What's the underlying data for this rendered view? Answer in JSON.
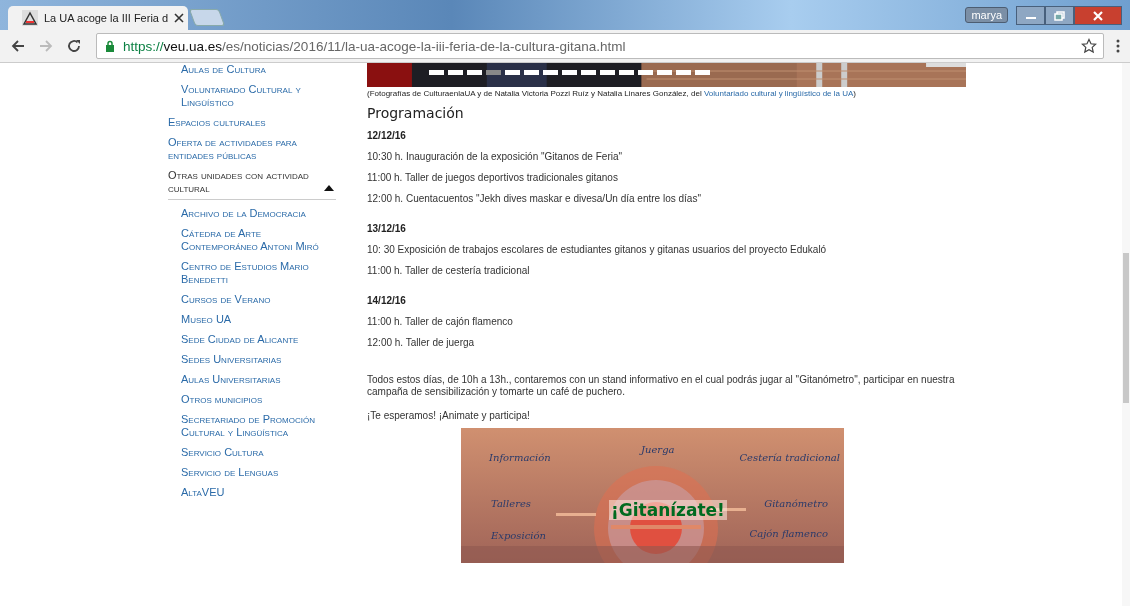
{
  "browser": {
    "tab": {
      "title": "La UA acoge la III Feria d",
      "selected": true
    },
    "user": "marya",
    "url": {
      "scheme": "https://",
      "host": "veu.ua.es",
      "path": "/es/noticias/2016/11/la-ua-acoge-la-iii-feria-de-la-cultura-gitana.html"
    }
  },
  "sidebar": {
    "items_continued": [
      {
        "label": "Aulas de Cultura"
      },
      {
        "label": "Voluntariado Cultural y Lingüístico"
      }
    ],
    "items": [
      {
        "label": "Espacios culturales"
      },
      {
        "label": "Oferta de actividades para entidades públicas"
      },
      {
        "label": "Otras unidades con actividad cultural",
        "expanded": true,
        "children": [
          {
            "label": "Archivo de la Democracia"
          },
          {
            "label": "Cátedra de Arte Contemporáneo Antoni Miró"
          },
          {
            "label": "Centro de Estudios Mario Benedetti"
          },
          {
            "label": "Cursos de Verano"
          },
          {
            "label": "Museo UA"
          },
          {
            "label": "Sede Ciudad de Alicante"
          },
          {
            "label": "Sedes Universitarias"
          },
          {
            "label": "Aulas Universitarias"
          },
          {
            "label": "Otros municipios"
          },
          {
            "label": "Secretariado de Promoción Cultural y Lingüística"
          },
          {
            "label": "Servicio Cultura"
          },
          {
            "label": "Servicio de Lenguas"
          },
          {
            "label": "AltaVEU"
          }
        ]
      }
    ]
  },
  "slideshow": {
    "dots": [
      {
        "selected": false
      },
      {
        "selected": false
      },
      {
        "selected": false
      },
      {
        "selected": true
      },
      {
        "selected": false
      },
      {
        "selected": false
      },
      {
        "selected": false
      },
      {
        "selected": false
      },
      {
        "selected": false
      },
      {
        "selected": false
      },
      {
        "selected": false
      },
      {
        "selected": false
      },
      {
        "selected": false
      },
      {
        "selected": false
      },
      {
        "selected": false
      }
    ]
  },
  "caption": {
    "text": "(Fotografías de CulturaenlaUA y de Natalia Victoria Pozzi Ruíz y Natalia Linares González, del ",
    "link": "Voluntariado cultural y lingüístico de la UA",
    "end": ")"
  },
  "heading": "Programación",
  "days": [
    {
      "date": "12/12/16",
      "events": [
        "10:30 h. Inauguración de la exposición \"Gitanos de Feria\"",
        "11:00 h. Taller de juegos deportivos tradicionales gitanos",
        "12:00 h. Cuentacuentos \"Jekh dives maskar e divesa/Un día entre los días\""
      ]
    },
    {
      "date": "13/12/16",
      "events": [
        "10: 30 Exposición de trabajos escolares de estudiantes gitanos y gitanas usuarios del proyecto Edukaló",
        "11:00 h. Taller de cestería tradicional"
      ]
    },
    {
      "date": "14/12/16",
      "events": [
        "11:00 h. Taller de cajón flamenco",
        "12:00 h. Taller de juerga"
      ]
    }
  ],
  "paragraph": "Todos estos días, de 10h a 13h., contaremos con un stand informativo en el cual podrás jugar al \"Gitanómetro\", participar en nuestra campaña de sensibilización y tomarte un café de puchero.",
  "closing": "¡Te esperamos! ¡Animate y participa!",
  "poster": {
    "words": [
      {
        "text": "Información",
        "kind": "word"
      },
      {
        "text": "Juerga",
        "kind": "word"
      },
      {
        "text": "Cestería tradicional",
        "kind": "word"
      },
      {
        "text": "Talleres",
        "kind": "word"
      },
      {
        "text": "¡Gitanízate!",
        "kind": "title"
      },
      {
        "text": "Gitanómetro",
        "kind": "word"
      },
      {
        "text": "Exposición",
        "kind": "word"
      },
      {
        "text": "Cajón flamenco",
        "kind": "word"
      }
    ]
  }
}
